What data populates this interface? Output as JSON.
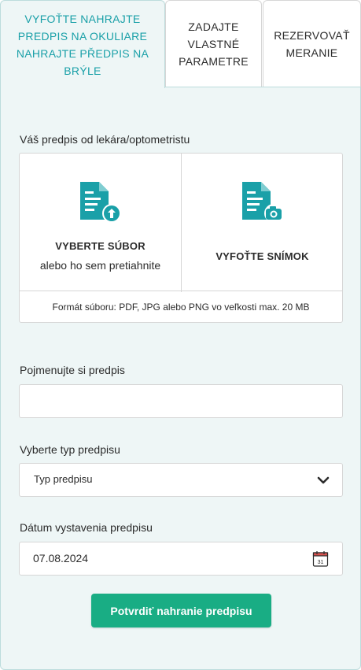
{
  "tabs": [
    {
      "label": "Vyfoťte nahrajte predpis na okuliare nahrajte předpis na brýle",
      "active": true
    },
    {
      "label": "Zadajte vlastné parametre",
      "active": false
    },
    {
      "label": "Rezervovať meranie",
      "active": false
    }
  ],
  "prescription": {
    "label": "Váš predpis od lekára/optometristu",
    "upload_title": "VYBERTE SÚBOR",
    "upload_sub": "alebo ho sem pretiahnite",
    "photo_title": "VYFOŤTE SNÍMOK",
    "format_note": "Formát súboru: PDF, JPG alebo PNG vo veľkosti max. 20 MB"
  },
  "name_field": {
    "label": "Pojmenujte si predpis",
    "value": ""
  },
  "type_field": {
    "label": "Vyberte typ predpisu",
    "selected": "Typ predpisu"
  },
  "date_field": {
    "label": "Dátum vystavenia predpisu",
    "value": "07.08.2024",
    "calendar_day": "31"
  },
  "submit_label": "Potvrdiť nahranie predpisu",
  "colors": {
    "accent": "#1aa0a8",
    "button": "#19ad84",
    "panel_bg": "#eef6f6"
  },
  "icons": [
    "upload-file-icon",
    "camera-file-icon",
    "chevron-down-icon",
    "calendar-icon"
  ]
}
